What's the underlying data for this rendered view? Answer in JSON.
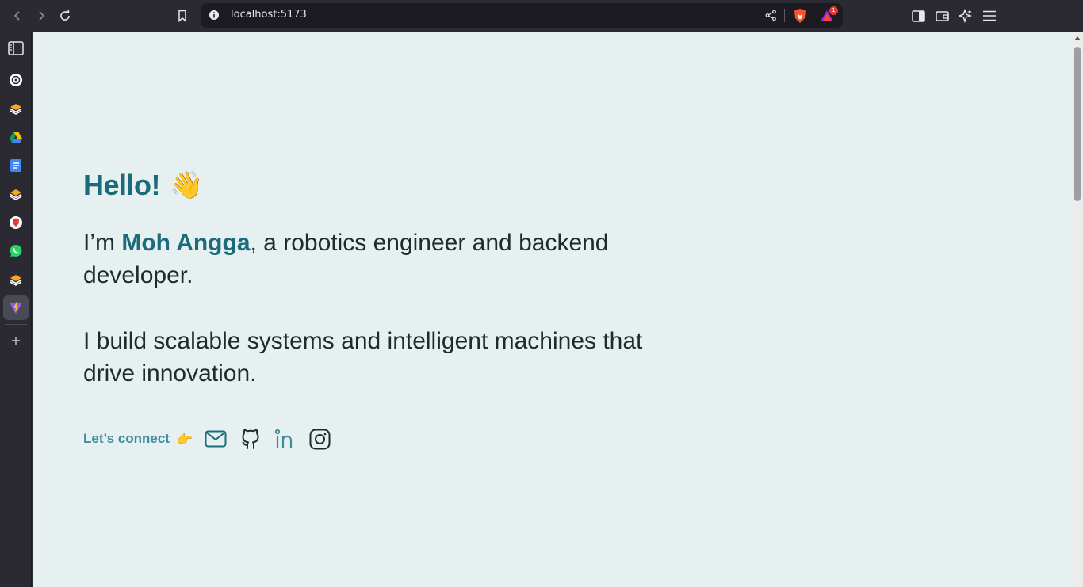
{
  "browser": {
    "url": "localhost:5173",
    "notification_count": "1"
  },
  "page": {
    "greeting": "Hello!",
    "greeting_emoji": "👋",
    "intro_prefix": "I’m ",
    "name": "Moh Angga",
    "intro_suffix": ", a robotics engineer and backend developer.",
    "description": "I build scalable systems and intelligent machines that drive innovation.",
    "connect_label": "Let’s connect",
    "connect_emoji": "👉"
  },
  "colors": {
    "accent": "#1b6b7a",
    "connect": "#3d8fa0",
    "background": "#e6f0f0",
    "text": "#1f2a2c"
  },
  "socials": [
    "mail-icon",
    "github-icon",
    "linkedin-icon",
    "instagram-icon"
  ],
  "sidebar_icons": [
    "sidebar-toggle-icon",
    "openai-icon",
    "stack-icon",
    "google-drive-icon",
    "google-docs-icon",
    "stack-icon",
    "brave-icon",
    "whatsapp-icon",
    "stack-icon",
    "vite-icon",
    "add-icon"
  ]
}
